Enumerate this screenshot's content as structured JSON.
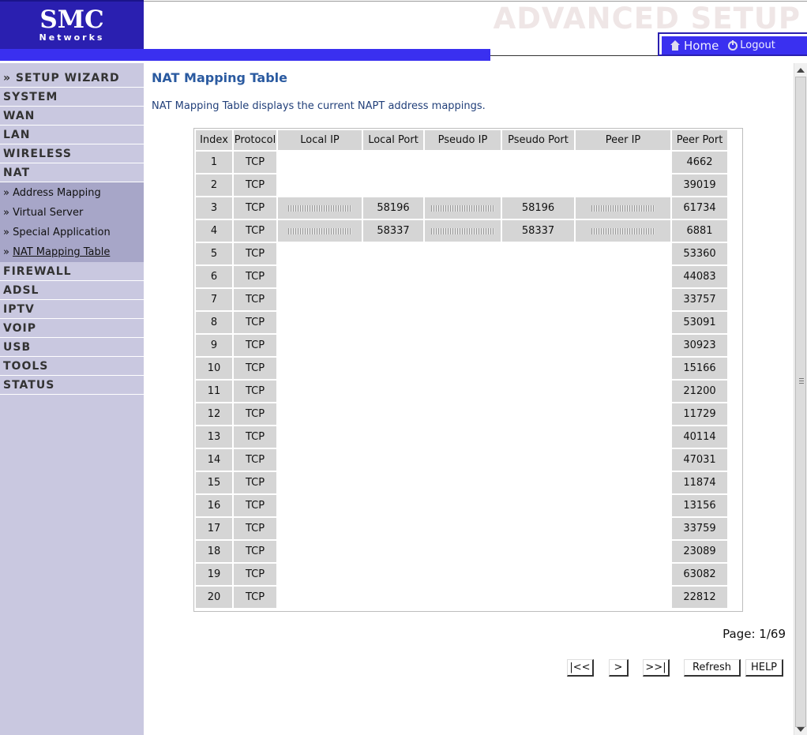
{
  "header": {
    "logo_main": "SMC",
    "logo_sub": "Networks",
    "title": "ADVANCED SETUP",
    "nav": {
      "home": "Home",
      "logout": "Logout"
    }
  },
  "sidebar": {
    "items": [
      {
        "label": "» SETUP WIZARD"
      },
      {
        "label": "SYSTEM"
      },
      {
        "label": "WAN"
      },
      {
        "label": "LAN"
      },
      {
        "label": "WIRELESS"
      },
      {
        "label": "NAT"
      }
    ],
    "nat_sub": [
      {
        "label": "» Address Mapping"
      },
      {
        "label": "» Virtual Server"
      },
      {
        "label": "» Special Application"
      },
      {
        "prefix": "» ",
        "label": "NAT Mapping Table"
      }
    ],
    "items_after": [
      {
        "label": "FIREWALL"
      },
      {
        "label": "ADSL"
      },
      {
        "label": "IPTV"
      },
      {
        "label": "VOIP"
      },
      {
        "label": "USB"
      },
      {
        "label": "TOOLS"
      },
      {
        "label": "STATUS"
      }
    ]
  },
  "main": {
    "title": "NAT Mapping Table",
    "description": "NAT Mapping Table displays the current NAPT address mappings.",
    "table": {
      "columns": [
        "Index",
        "Protocol",
        "Local IP",
        "Local Port",
        "Pseudo IP",
        "Pseudo Port",
        "Peer IP",
        "Peer Port"
      ],
      "rows": [
        {
          "index": "1",
          "protocol": "TCP",
          "local_ip": "",
          "local_port": "",
          "pseudo_ip": "",
          "pseudo_port": "",
          "peer_ip": "",
          "peer_port": "4662"
        },
        {
          "index": "2",
          "protocol": "TCP",
          "local_ip": "",
          "local_port": "",
          "pseudo_ip": "",
          "pseudo_port": "",
          "peer_ip": "",
          "peer_port": "39019"
        },
        {
          "index": "3",
          "protocol": "TCP",
          "local_ip": "",
          "local_port": "58196",
          "pseudo_ip": "",
          "pseudo_port": "58196",
          "peer_ip": "",
          "peer_port": "61734"
        },
        {
          "index": "4",
          "protocol": "TCP",
          "local_ip": "",
          "local_port": "58337",
          "pseudo_ip": "",
          "pseudo_port": "58337",
          "peer_ip": "",
          "peer_port": "6881"
        },
        {
          "index": "5",
          "protocol": "TCP",
          "peer_port": "53360"
        },
        {
          "index": "6",
          "protocol": "TCP",
          "peer_port": "44083"
        },
        {
          "index": "7",
          "protocol": "TCP",
          "peer_port": "33757"
        },
        {
          "index": "8",
          "protocol": "TCP",
          "peer_port": "53091"
        },
        {
          "index": "9",
          "protocol": "TCP",
          "peer_port": "30923"
        },
        {
          "index": "10",
          "protocol": "TCP",
          "peer_port": "15166"
        },
        {
          "index": "11",
          "protocol": "TCP",
          "peer_port": "21200"
        },
        {
          "index": "12",
          "protocol": "TCP",
          "peer_port": "11729"
        },
        {
          "index": "13",
          "protocol": "TCP",
          "peer_port": "40114"
        },
        {
          "index": "14",
          "protocol": "TCP",
          "peer_port": "47031"
        },
        {
          "index": "15",
          "protocol": "TCP",
          "peer_port": "11874"
        },
        {
          "index": "16",
          "protocol": "TCP",
          "peer_port": "13156"
        },
        {
          "index": "17",
          "protocol": "TCP",
          "peer_port": "33759"
        },
        {
          "index": "18",
          "protocol": "TCP",
          "peer_port": "23089"
        },
        {
          "index": "19",
          "protocol": "TCP",
          "peer_port": "63082"
        },
        {
          "index": "20",
          "protocol": "TCP",
          "peer_port": "22812"
        }
      ]
    },
    "page_info": "Page: 1/69",
    "buttons": {
      "first": "|<<",
      "next": ">",
      "last": ">>|",
      "refresh": "Refresh",
      "help": "HELP"
    }
  },
  "icons": {
    "home": "home-icon",
    "logout": "logout-icon"
  },
  "colors": {
    "brand_blue": "#2a1fb0",
    "bar_blue": "#3a30f0",
    "sidebar_bg": "#c9c8e0",
    "title_blue": "#2a5aa0"
  }
}
